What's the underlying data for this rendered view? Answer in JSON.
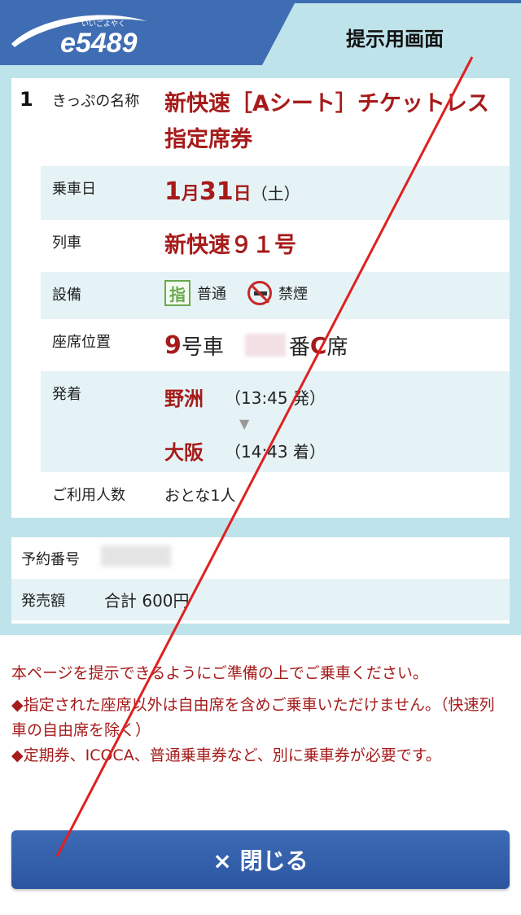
{
  "header": {
    "logo_text": "e5489",
    "logo_kana": "いいごよやく",
    "tab_title": "提示用画面"
  },
  "ticket": {
    "index": "1",
    "rows": {
      "name_label": "きっぷの名称",
      "name_value": "新快速［Aシート］チケットレス指定席券",
      "date_label": "乗車日",
      "date_month": "1",
      "date_month_unit": "月",
      "date_day": "31",
      "date_day_unit": "日",
      "date_weekday": "（土）",
      "train_label": "列車",
      "train_value": "新快速９１号",
      "equip_label": "設備",
      "equip_shitei_icon": "指",
      "equip_class": "普通",
      "equip_smoking": "禁煙",
      "seat_label": "座席位置",
      "seat_car_num": "9",
      "seat_car_unit": "号車",
      "seat_no_suffix": "番",
      "seat_letter": "C",
      "seat_suffix": "席",
      "route_label": "発着",
      "dep_station": "野洲",
      "dep_time": "（13:45 発）",
      "arr_station": "大阪",
      "arr_time": "（14:43 着）",
      "passengers_label": "ご利用人数",
      "passengers_value": "おとな1人"
    }
  },
  "reservation": {
    "number_label": "予約番号",
    "amount_label": "発売額",
    "amount_value": "合計 600円"
  },
  "notices": {
    "line1": "本ページを提示できるようにご準備の上でご乗車ください。",
    "line2": "◆指定された座席以外は自由席を含めご乗車いただけません。（快速列車の自由席を除く）",
    "line3": "◆定期券、ICOCA、普通乗車券など、別に乗車券が必要です。"
  },
  "close_button": {
    "label": "× 閉じる"
  },
  "colors": {
    "header_blue": "#3f6db3",
    "background_teal": "#bfe3ea",
    "row_alt": "#e6f3f6",
    "accent_red": "#a61b1b",
    "annotation_red": "#e02020"
  }
}
